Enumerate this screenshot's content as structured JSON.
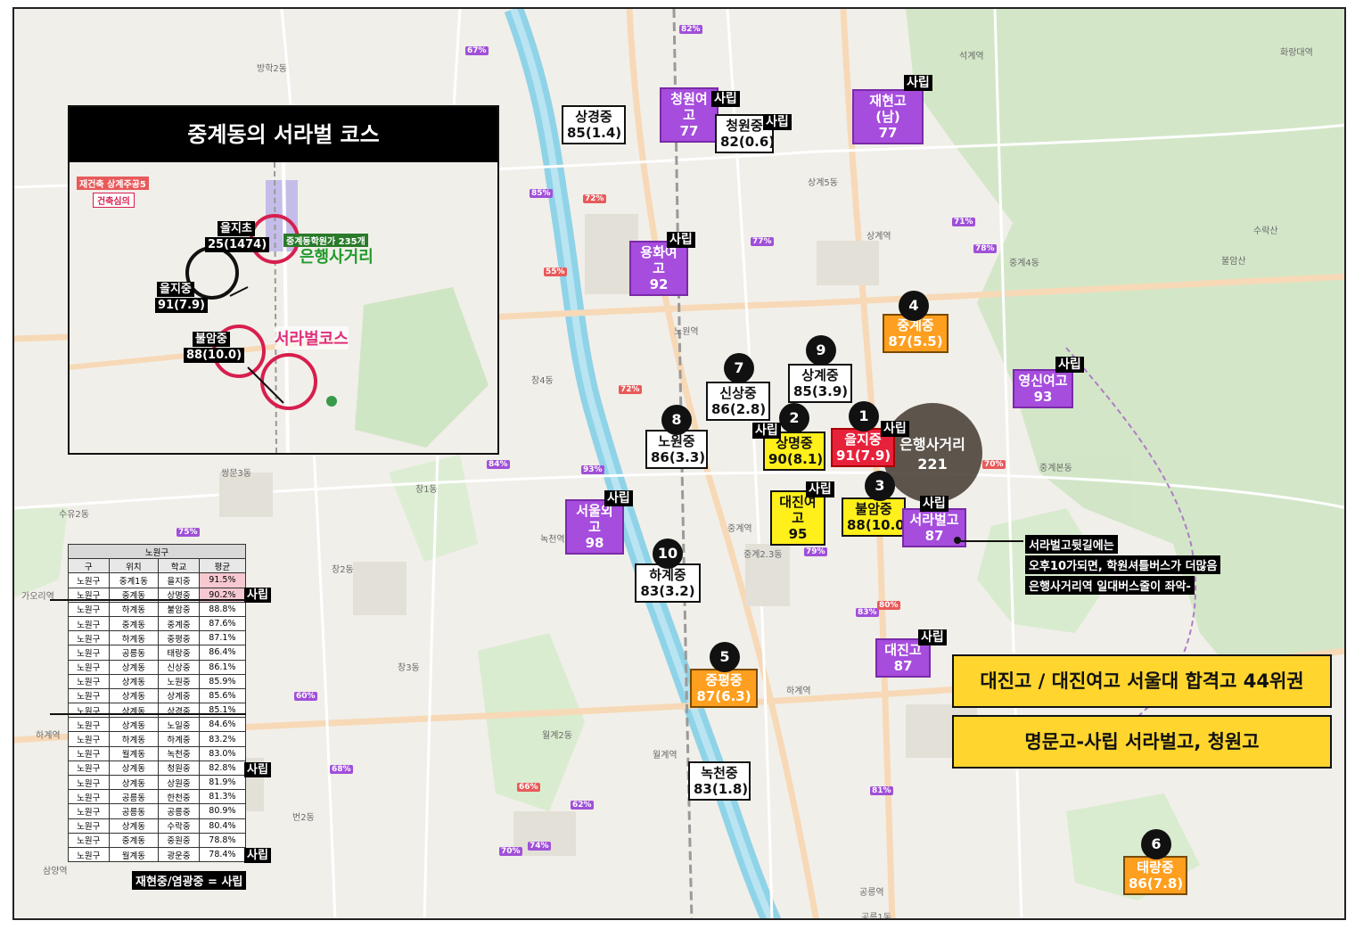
{
  "inset": {
    "title": "중계동의 서라벌 코스",
    "labels": {
      "reconstruction": "재건축 상계주공5",
      "construction_review": "건축심의",
      "eulji_elem": "을지초",
      "eulji_elem_score": "25(1474)",
      "eulji_mid": "을지중",
      "eulji_mid_score": "91(7.9)",
      "bulam": "불암중",
      "bulam_score": "88(10.0)",
      "bank_crossroad": "은행사거리",
      "seorabeol_course": "서라벌코스",
      "academy_street": "중계동학원가 235개"
    }
  },
  "map_labels": {
    "seokgye": "석계역",
    "banghak2": "방학2동",
    "gwanghwa": "광운대역",
    "sanggye5": "상계5동",
    "sanggye_stn": "상계역",
    "junggye4": "중계4동",
    "junggye_bon": "중계본동",
    "nowon_stn": "노원역",
    "chang4": "창4동",
    "chang2": "창2동",
    "chang3": "창3동",
    "chang1": "창1동",
    "ssangmun3": "쌍문3동",
    "suyu2": "수유2동",
    "junggye23": "중계2.3동",
    "junggye_stn": "중계역",
    "hagye_stn": "하계역",
    "wolgye2": "월계2동",
    "wolgye_stn": "월계역",
    "beon2": "번2동",
    "gongneung_stn": "공릉역",
    "gongneung1": "공릉1동",
    "gaori": "가오리역",
    "hagye_stn2": "하계역",
    "nokcheon_stn": "녹천역",
    "sammyeong": "삼양역",
    "buram_mt": "불암산",
    "suraksan": "수락산",
    "hwarang": "화랑대역"
  },
  "schools": [
    {
      "name": "상경중",
      "score": "85(1.4)",
      "style": "white"
    },
    {
      "name": "청원여고",
      "score": "77",
      "style": "purple",
      "tag": "사립"
    },
    {
      "name": "청원중",
      "score": "82(0.6)",
      "style": "white",
      "tag": "사립"
    },
    {
      "name": "재현고(남)",
      "score": "77",
      "style": "purple",
      "tag": "사립"
    },
    {
      "name": "용화여고",
      "score": "92",
      "style": "purple",
      "tag": "사립"
    },
    {
      "name": "중계중",
      "score": "87(5.5)",
      "style": "orange",
      "rank": "4"
    },
    {
      "name": "상계중",
      "score": "85(3.9)",
      "style": "white",
      "rank": "9"
    },
    {
      "name": "신상중",
      "score": "86(2.8)",
      "style": "white",
      "rank": "7"
    },
    {
      "name": "노원중",
      "score": "86(3.3)",
      "style": "white",
      "rank": "8"
    },
    {
      "name": "상명중",
      "score": "90(8.1)",
      "style": "yellow",
      "rank": "2",
      "tag": "사립"
    },
    {
      "name": "을지중",
      "score": "91(7.9)",
      "style": "red",
      "rank": "1",
      "tag": "사립"
    },
    {
      "name": "영신여고",
      "score": "93",
      "style": "purple",
      "tag": "사립"
    },
    {
      "name": "대진여고",
      "score": "95",
      "style": "yellow",
      "tag": "사립"
    },
    {
      "name": "불암중",
      "score": "88(10.0)",
      "style": "yellow",
      "rank": "3"
    },
    {
      "name": "서라벌고",
      "score": "87",
      "style": "purple",
      "tag": "사립"
    },
    {
      "name": "서울외고",
      "score": "98",
      "style": "purple",
      "tag": "사립"
    },
    {
      "name": "하계중",
      "score": "83(3.2)",
      "style": "white",
      "rank": "10"
    },
    {
      "name": "중평중",
      "score": "87(6.3)",
      "style": "orange",
      "rank": "5"
    },
    {
      "name": "대진고",
      "score": "87",
      "style": "purple",
      "tag": "사립"
    },
    {
      "name": "녹천중",
      "score": "83(1.8)",
      "style": "white"
    },
    {
      "name": "태랑중",
      "score": "86(7.8)",
      "style": "orange",
      "rank": "6"
    }
  ],
  "hub": {
    "name": "은행사거리",
    "count": "221"
  },
  "annotation": [
    "서라벌고뒷길에는",
    "오후10가되면, 학원셔틀버스가 더많음",
    "은행사거리역 일대버스줄이 좌악-"
  ],
  "banners": [
    "대진고 / 대진여고 서울대 합격고 44위권",
    "명문고-사립 서라벌고, 청원고"
  ],
  "table": {
    "title": "노원구",
    "headers": [
      "구",
      "위치",
      "학교",
      "평균"
    ],
    "rows": [
      [
        "노원구",
        "중계1동",
        "을지중",
        "91.5%"
      ],
      [
        "노원구",
        "중계동",
        "상명중",
        "90.2%"
      ],
      [
        "노원구",
        "하계동",
        "불암중",
        "88.8%"
      ],
      [
        "노원구",
        "중계동",
        "중계중",
        "87.6%"
      ],
      [
        "노원구",
        "하계동",
        "중평중",
        "87.1%"
      ],
      [
        "노원구",
        "공릉동",
        "태랑중",
        "86.4%"
      ],
      [
        "노원구",
        "상계동",
        "신상중",
        "86.1%"
      ],
      [
        "노원구",
        "상계동",
        "노원중",
        "85.9%"
      ],
      [
        "노원구",
        "상계동",
        "상계중",
        "85.6%"
      ],
      [
        "노원구",
        "상계동",
        "상경중",
        "85.1%"
      ],
      [
        "노원구",
        "상계동",
        "노일중",
        "84.6%"
      ],
      [
        "노원구",
        "하계동",
        "하계중",
        "83.2%"
      ],
      [
        "노원구",
        "월계동",
        "녹천중",
        "83.0%"
      ],
      [
        "노원구",
        "상계동",
        "청원중",
        "82.8%"
      ],
      [
        "노원구",
        "상계동",
        "상원중",
        "81.9%"
      ],
      [
        "노원구",
        "공릉동",
        "한천중",
        "81.3%"
      ],
      [
        "노원구",
        "공릉동",
        "공릉중",
        "80.9%"
      ],
      [
        "노원구",
        "상계동",
        "수락중",
        "80.4%"
      ],
      [
        "노원구",
        "중계동",
        "중원중",
        "78.8%"
      ],
      [
        "노원구",
        "월계동",
        "광운중",
        "78.4%"
      ]
    ],
    "private_tag": "사립",
    "footnote": "재현중/염광중 = 사립"
  },
  "colors": {
    "purple": "#a64ddd",
    "yellow": "#ffef1a",
    "orange": "#ff9f1f",
    "red": "#e8213b",
    "banner": "#ffd52e",
    "river": "#8fd3e8",
    "park": "#cfe6c4"
  }
}
